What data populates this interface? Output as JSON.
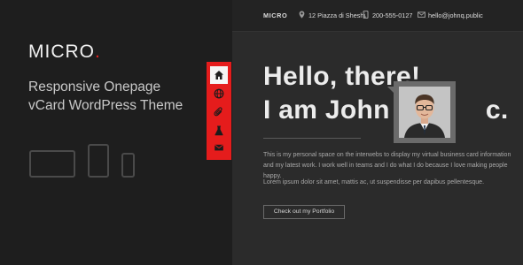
{
  "promo": {
    "brand_name": "MICRO",
    "brand_dot": ".",
    "tagline_line1": "Responsive Onepage",
    "tagline_line2": "vCard WordPress Theme",
    "accent_color": "#e81d1d",
    "devices": [
      "laptop-icon",
      "tablet-icon",
      "phone-icon"
    ]
  },
  "nav": {
    "items": [
      {
        "icon": "home-icon",
        "active": true
      },
      {
        "icon": "globe-icon",
        "active": false
      },
      {
        "icon": "paperclip-icon",
        "active": false
      },
      {
        "icon": "flask-icon",
        "active": false
      },
      {
        "icon": "mail-icon",
        "active": false
      }
    ],
    "background_color": "#e51c1c"
  },
  "header": {
    "brand": "MICRO",
    "address": "12 Piazza di Sheshi",
    "phone": "200-555-0127",
    "email": "hello@johnq.public"
  },
  "hero": {
    "line1": "Hello, there!",
    "line2": "I am John Pub",
    "line2_end": "c.",
    "paragraph1": "This is my personal space on the interwebs to display my virtual business card information and my latest work. I work well in teams and I do what I do because I love making people happy.",
    "paragraph2": "Lorem ipsum dolor sit amet, mattis ac, ut suspendisse per dapibus pellentesque.",
    "cta_label": "Check out my Portfolio"
  }
}
